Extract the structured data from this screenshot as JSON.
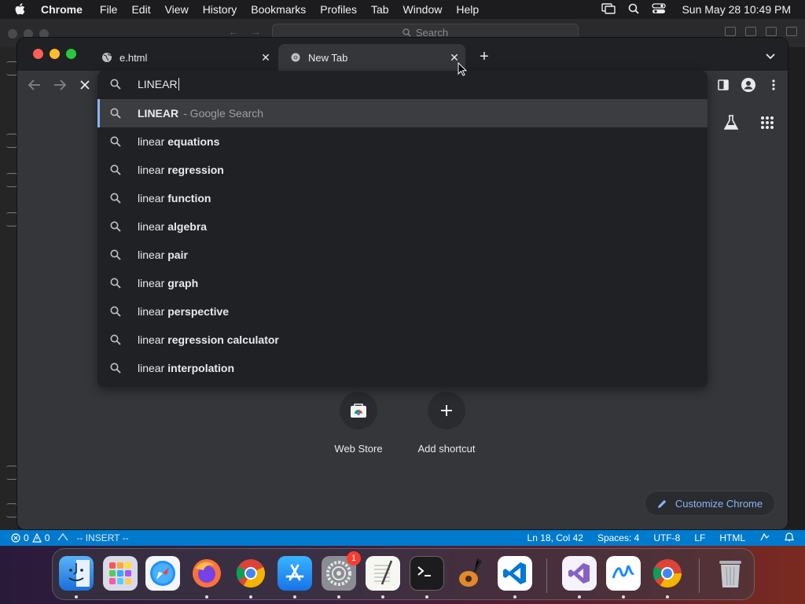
{
  "menubar": {
    "app_name": "Chrome",
    "items": [
      "File",
      "Edit",
      "View",
      "History",
      "Bookmarks",
      "Profiles",
      "Tab",
      "Window",
      "Help"
    ],
    "clock": "Sun May 28  10:49 PM"
  },
  "background_window": {
    "search_placeholder": "Search"
  },
  "chrome": {
    "tabs": [
      {
        "title": "e.html",
        "active": false
      },
      {
        "title": "New Tab",
        "active": true
      }
    ],
    "omnibox": {
      "value": "LINEAR",
      "top_suggestion": {
        "main": "LINEAR",
        "sub": "- Google Search"
      },
      "suggestions": [
        {
          "prefix": "linear",
          "suffix": "equations"
        },
        {
          "prefix": "linear",
          "suffix": "regression"
        },
        {
          "prefix": "linear",
          "suffix": "function"
        },
        {
          "prefix": "linear",
          "suffix": "algebra"
        },
        {
          "prefix": "linear",
          "suffix": "pair"
        },
        {
          "prefix": "linear",
          "suffix": "graph"
        },
        {
          "prefix": "linear",
          "suffix": "perspective"
        },
        {
          "prefix": "linear",
          "suffix": "regression calculator"
        },
        {
          "prefix": "linear",
          "suffix": "interpolation"
        }
      ]
    },
    "shortcuts": [
      {
        "label": "Web Store"
      },
      {
        "label": "Add shortcut"
      }
    ],
    "customize_label": "Customize Chrome"
  },
  "statusbar": {
    "errors": "0",
    "warnings": "0",
    "mode": "-- INSERT --",
    "position": "Ln 18, Col 42",
    "spaces": "Spaces: 4",
    "encoding": "UTF-8",
    "eol": "LF",
    "language": "HTML"
  },
  "dock": {
    "apps": [
      "finder-icon",
      "launchpad-icon",
      "safari-icon",
      "firefox-icon",
      "chrome-icon",
      "app-store-icon",
      "system-settings-icon",
      "textedit-icon",
      "terminal-icon",
      "garageband-icon",
      "vscode-icon",
      "visual-studio-icon",
      "freeform-icon",
      "chrome-icon",
      "trash-icon"
    ],
    "settings_badge": "1"
  },
  "colors": {
    "accent": "#8ab4f8",
    "statusbar": "#007acc",
    "omnibox_bg": "#202124",
    "chrome_bg": "#35363a"
  }
}
